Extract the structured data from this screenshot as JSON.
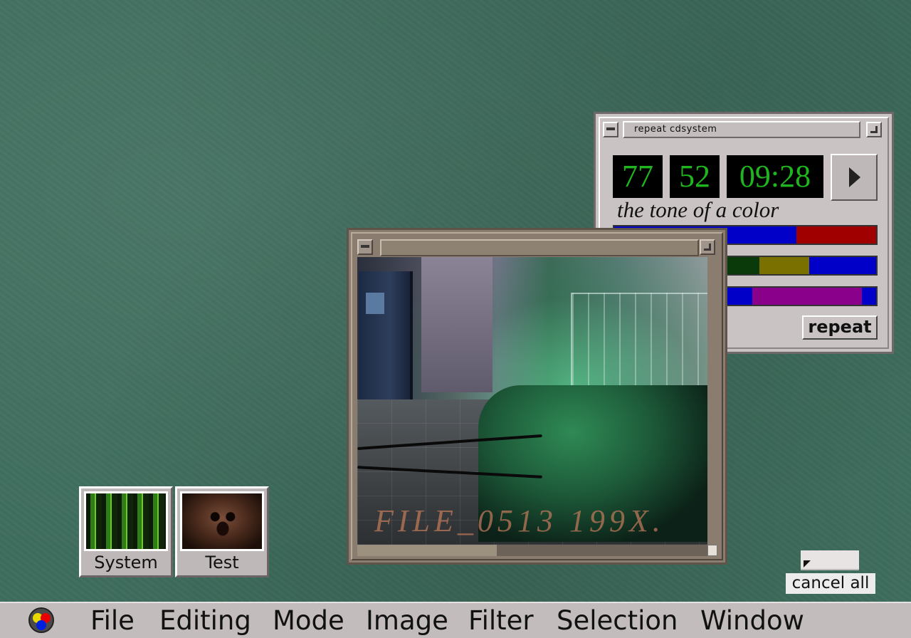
{
  "cd_player": {
    "title": "repeat  cdsystem",
    "track": "77",
    "index": "52",
    "time": "09:28",
    "play_icon": "play-triangle-icon",
    "tone_label": "the tone of a color",
    "bars": [
      [
        {
          "color": "#0000c8",
          "weight": 257
        },
        {
          "color": "#a00000",
          "weight": 112
        }
      ],
      [
        {
          "color": "#0000c8",
          "weight": 140
        },
        {
          "color": "#0a3a0a",
          "weight": 55
        },
        {
          "color": "#7a7000",
          "weight": 66
        },
        {
          "color": "#0000c8",
          "weight": 90
        }
      ],
      [
        {
          "color": "#0000c8",
          "weight": 195
        },
        {
          "color": "#8a008a",
          "weight": 155
        },
        {
          "color": "#0000c8",
          "weight": 20
        }
      ]
    ],
    "repeat_label": "repeat"
  },
  "video_window": {
    "caption": "FILE_0513  199X."
  },
  "desktop_icons": [
    {
      "label": "System"
    },
    {
      "label": "Test"
    }
  ],
  "cancel": {
    "label": "cancel all"
  },
  "menubar": {
    "items": [
      "File",
      "Editing",
      "Mode",
      "Image",
      "Filter",
      "Selection",
      "Window"
    ]
  },
  "colors": {
    "desktop": "#3f6e5e",
    "lcd_text": "#1fb51f",
    "lcd_bg": "#000000",
    "window_chrome": "#c9c3c3"
  }
}
